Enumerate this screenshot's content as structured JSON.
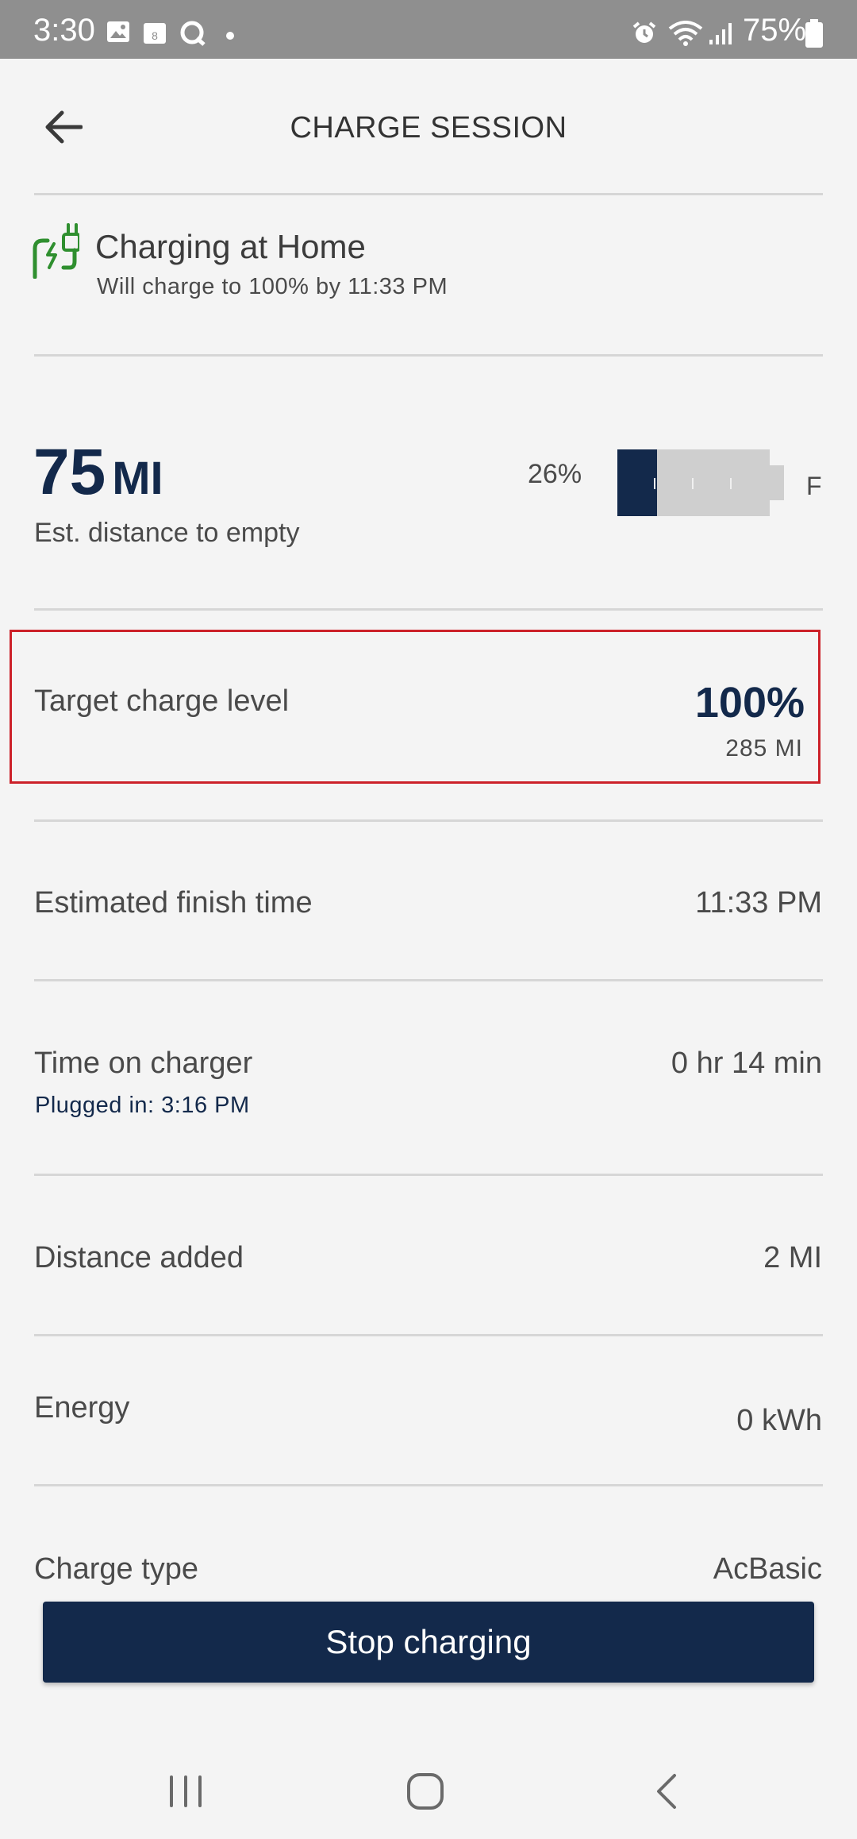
{
  "status_bar": {
    "time": "3:30",
    "notification_icons": [
      "image-icon",
      "calendar-icon",
      "chat-icon",
      "dot-icon"
    ],
    "system_icons": [
      "alarm-icon",
      "wifi-icon",
      "signal-icon"
    ],
    "battery_percent": "75%"
  },
  "header": {
    "title": "CHARGE SESSION"
  },
  "charging_status": {
    "icon": "charging-plug-icon",
    "icon_color": "#2f8f2f",
    "title": "Charging at Home",
    "subtitle": "Will charge to 100% by 11:33 PM"
  },
  "range": {
    "value": "75",
    "unit": "MI",
    "label": "Est. distance to empty",
    "battery_percent_label": "26%",
    "battery_level": 0.26,
    "full_label": "F"
  },
  "target_charge": {
    "label": "Target charge level",
    "value": "100%",
    "sub_value": "285 MI"
  },
  "rows": {
    "finish_time": {
      "label": "Estimated finish time",
      "value": "11:33 PM"
    },
    "time_on_charger": {
      "label": "Time on charger",
      "value": "0 hr 14 min",
      "sub": "Plugged in: 3:16 PM"
    },
    "distance_added": {
      "label": "Distance added",
      "value": "2 MI"
    },
    "energy": {
      "label": "Energy",
      "value": "0 kWh"
    },
    "charge_type": {
      "label": "Charge type",
      "value": "AcBasic"
    }
  },
  "actions": {
    "stop_label": "Stop charging"
  },
  "colors": {
    "brand_navy": "#13294b",
    "highlight_red": "#cc2129",
    "charging_green": "#2f8f2f"
  },
  "nav_bar": [
    "recents-icon",
    "home-icon",
    "back-icon"
  ]
}
